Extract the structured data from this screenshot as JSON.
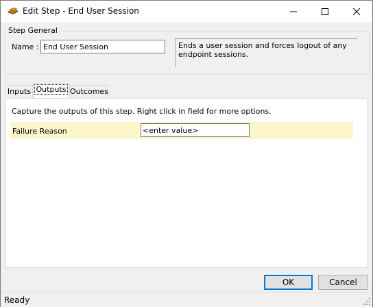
{
  "window": {
    "title": "Edit Step - End User Session",
    "app_icon": "stack-icon",
    "controls": [
      "minimize-icon",
      "maximize-icon",
      "close-icon"
    ]
  },
  "step_general": {
    "group_label": "Step General",
    "name_label": "Name :",
    "name_value": "End User Session",
    "description": "Ends a user session and forces logout of any endpoint sessions."
  },
  "tabs": [
    {
      "label": "Inputs",
      "active": false
    },
    {
      "label": "Outputs",
      "active": true
    },
    {
      "label": "Outcomes",
      "active": false
    }
  ],
  "outputs": {
    "instruction": "Capture the outputs of this step.  Right click in field for more options.",
    "rows": [
      {
        "label": "Failure Reason",
        "value": "<enter value>"
      }
    ],
    "row_color": "#fcf6cc"
  },
  "buttons": {
    "ok_label": "OK",
    "cancel_label": "Cancel"
  },
  "status": {
    "text": "Ready"
  },
  "colors": {
    "accent": "#0078d7"
  }
}
